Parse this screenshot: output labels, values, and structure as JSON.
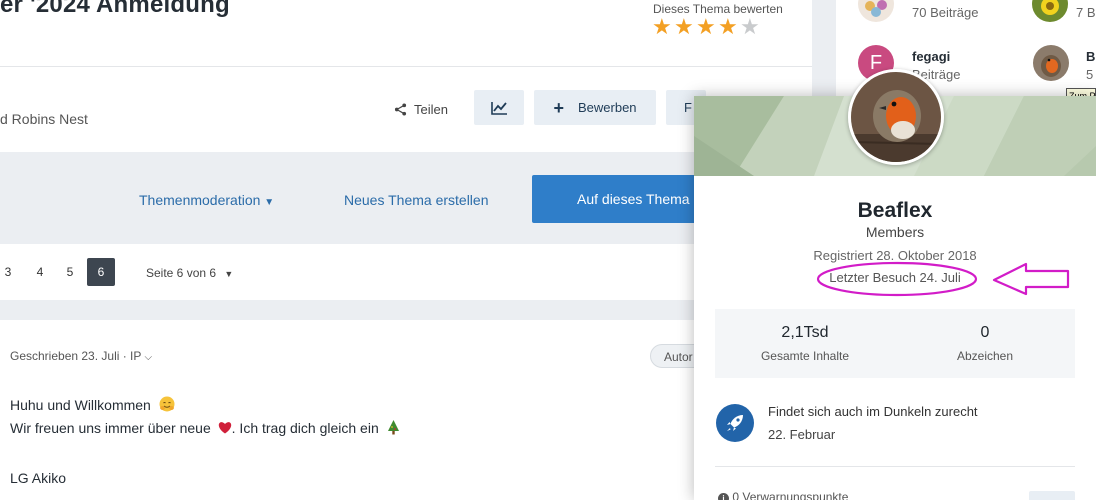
{
  "topic": {
    "title": "er '2024 Anmeldung",
    "rating_label": "Dieses Thema bewerten",
    "rating": 4,
    "rating_max": 5,
    "author_text": "d Robins Nest"
  },
  "actions": {
    "share_label": "Teilen",
    "apply_label": "Bewerben",
    "follow_label": "F"
  },
  "toolbar": {
    "moderation_label": "Themenmoderation",
    "new_topic_label": "Neues Thema erstellen",
    "reply_label": "Auf dieses Thema"
  },
  "pagination": {
    "pages": [
      "3",
      "4",
      "5",
      "6"
    ],
    "active": "6",
    "info": "Seite 6 von 6"
  },
  "post": {
    "meta": "Geschrieben 23. Juli · IP",
    "author_badge": "Autor",
    "greeting": "Huhu und Willkommen",
    "line2_a": "Wir freuen uns immer über neue",
    "line2_b": ". Ich trag dich gleich ein",
    "signoff": "LG Akiko"
  },
  "sidebar": {
    "users": [
      {
        "name": "",
        "count": "70 Beiträge"
      },
      {
        "name": "",
        "count": "7 B"
      },
      {
        "name": "fegagi",
        "initial": "F",
        "count": "Beiträge"
      },
      {
        "name": "B",
        "count": "5"
      }
    ],
    "tooltip": "Zum P"
  },
  "card": {
    "name": "Beaflex",
    "group": "Members",
    "joined": "Registriert 28. Oktober 2018",
    "last_visit": "Letzter Besuch 24. Juli",
    "content_count": "2,1Tsd",
    "content_label": "Gesamte Inhalte",
    "badges_count": "0",
    "badges_label": "Abzeichen",
    "rank_title": "Findet sich auch im Dunkeln zurecht",
    "rank_date": "22. Februar",
    "warnings": "0 Verwarnungspunkte"
  },
  "colors": {
    "accent": "#2f7ec9",
    "star": "#f3a024",
    "annotation": "#d21cc8",
    "heart": "#d0203a"
  }
}
